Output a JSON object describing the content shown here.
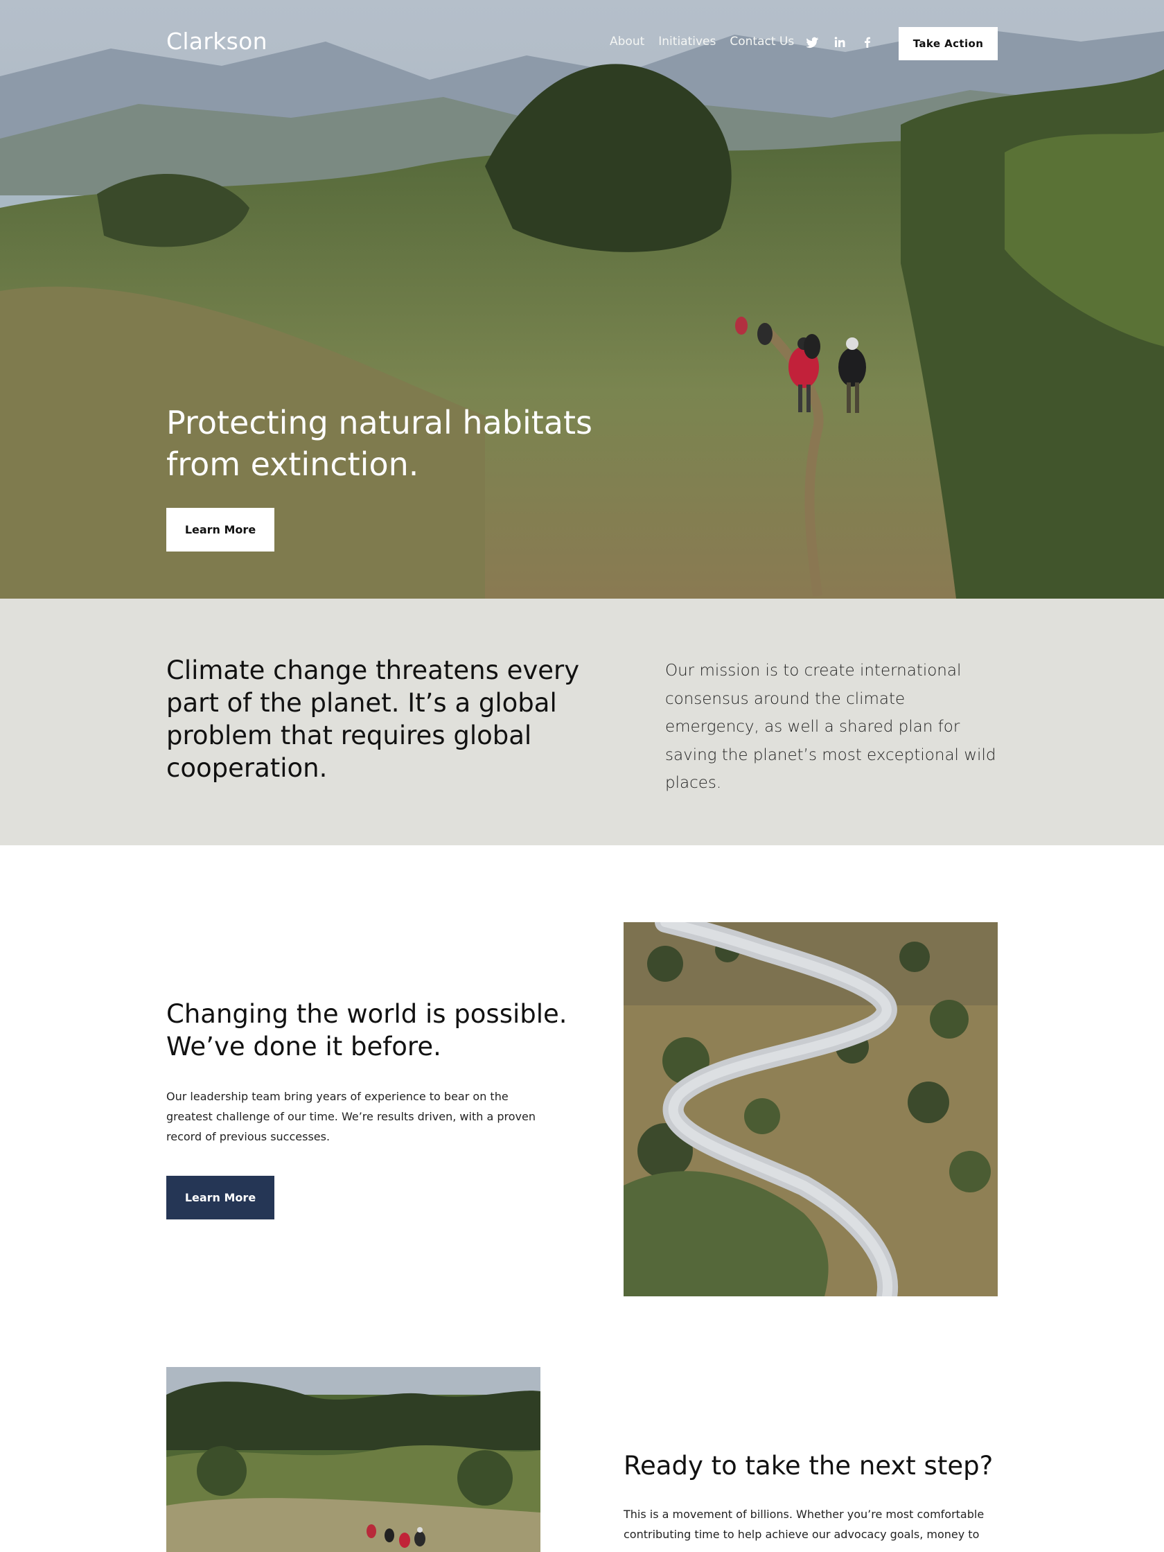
{
  "header": {
    "logo": "Clarkson",
    "nav": [
      "About",
      "Initiatives",
      "Contact Us"
    ],
    "social": [
      "twitter-icon",
      "linkedin-icon",
      "facebook-icon"
    ],
    "cta_label": "Take Action"
  },
  "hero": {
    "title": "Protecting natural habitats from extinction.",
    "button_label": "Learn More"
  },
  "mission": {
    "heading": "Climate change threatens every part of the planet. It’s a global problem that requires global cooperation.",
    "text": "Our mission is to create international consensus around the climate emergency, as well a shared plan for saving the planet’s most exceptional wild places."
  },
  "change": {
    "heading": "Changing the world is possible. We’ve done it before.",
    "body": "Our leadership team bring years of experience to bear on the greatest challenge of our time. We’re results driven, with a proven record of previous successes.",
    "button_label": "Learn More"
  },
  "next_step": {
    "heading": "Ready to take the next step?",
    "body": "This is a movement of billions. Whether you’re most comfortable contributing time to help achieve our advocacy goals, money to"
  },
  "colors": {
    "mission_band": "#e0e0db",
    "primary_button": "#253655",
    "white": "#ffffff"
  }
}
